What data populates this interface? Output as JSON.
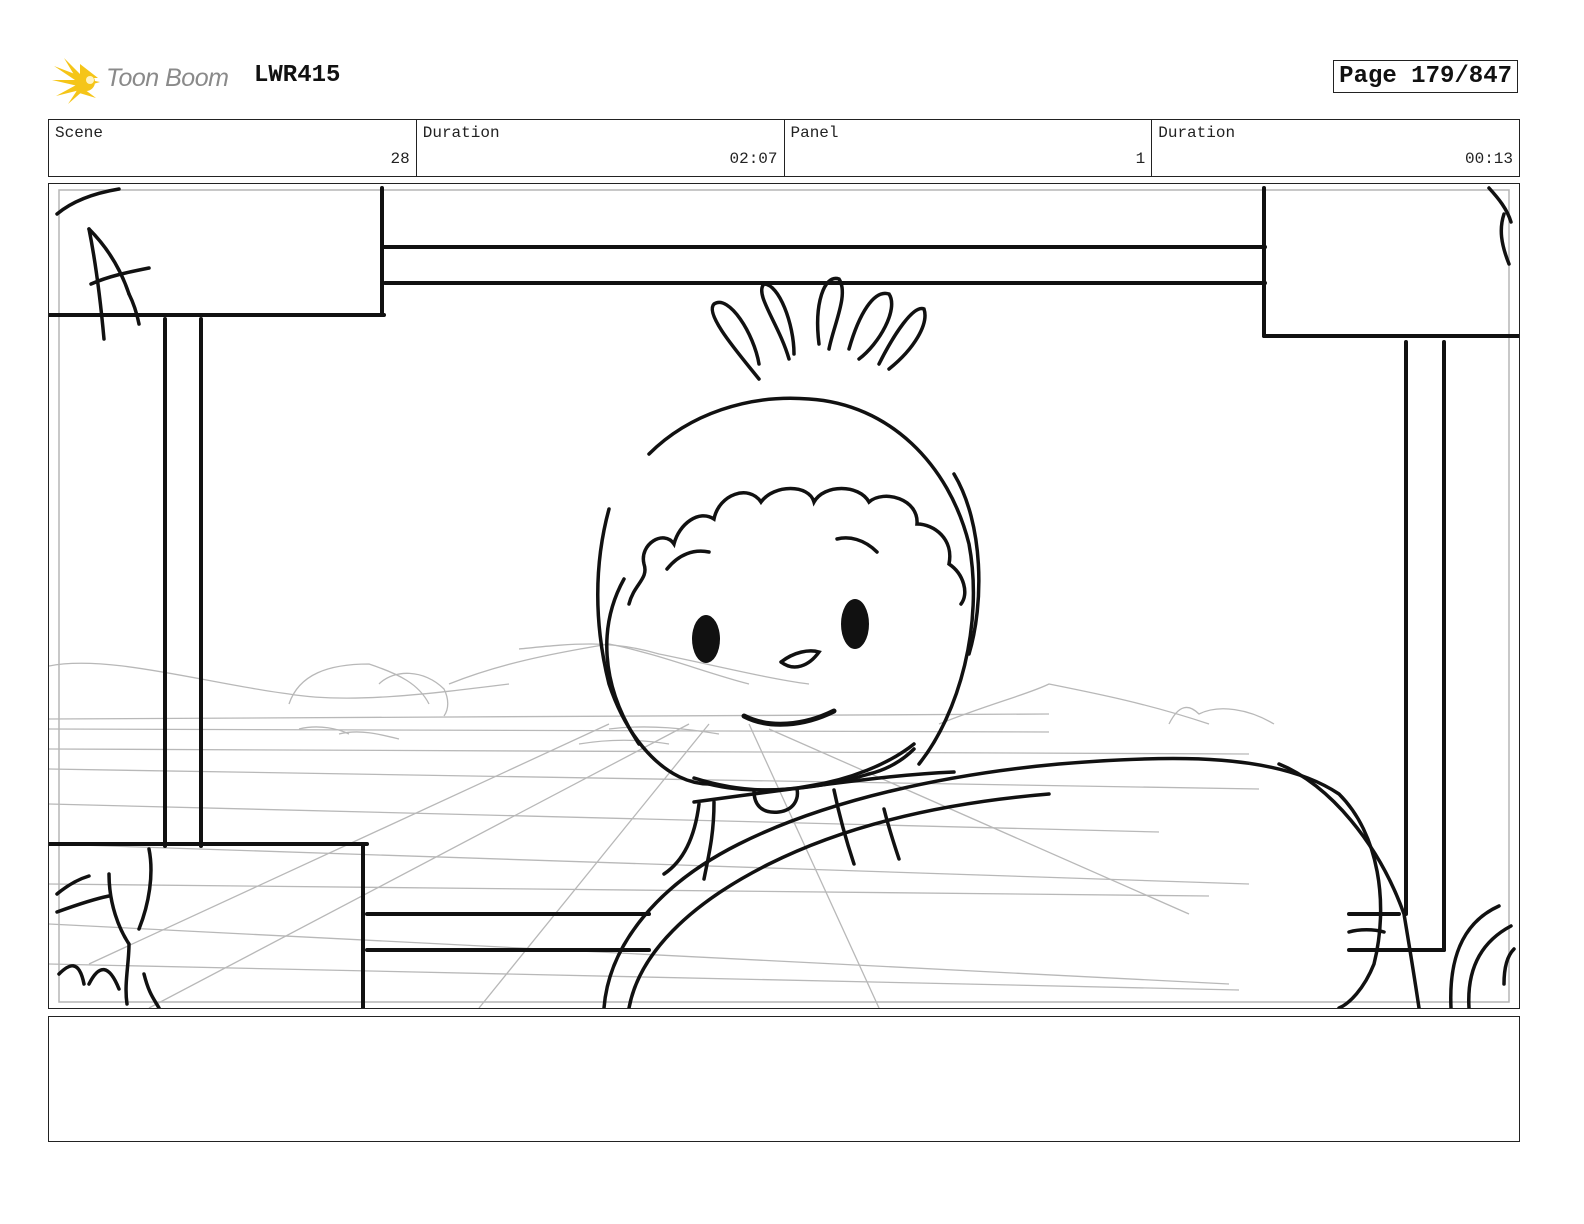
{
  "header": {
    "brand": "Toon Boom",
    "project": "LWR415",
    "page_label": "Page 179/847"
  },
  "info": {
    "scene_label": "Scene",
    "scene_value": "28",
    "scene_duration_label": "Duration",
    "scene_duration_value": "02:07",
    "panel_label": "Panel",
    "panel_value": "1",
    "panel_duration_label": "Duration",
    "panel_duration_value": "00:13"
  },
  "colors": {
    "logo_yellow": "#f5c518",
    "logo_text": "#8a8a8a",
    "ink": "#111111",
    "sketch_light": "#b5b5b5"
  },
  "icons": {
    "logo": "starburst-logo-icon"
  },
  "notes": {
    "text": ""
  }
}
